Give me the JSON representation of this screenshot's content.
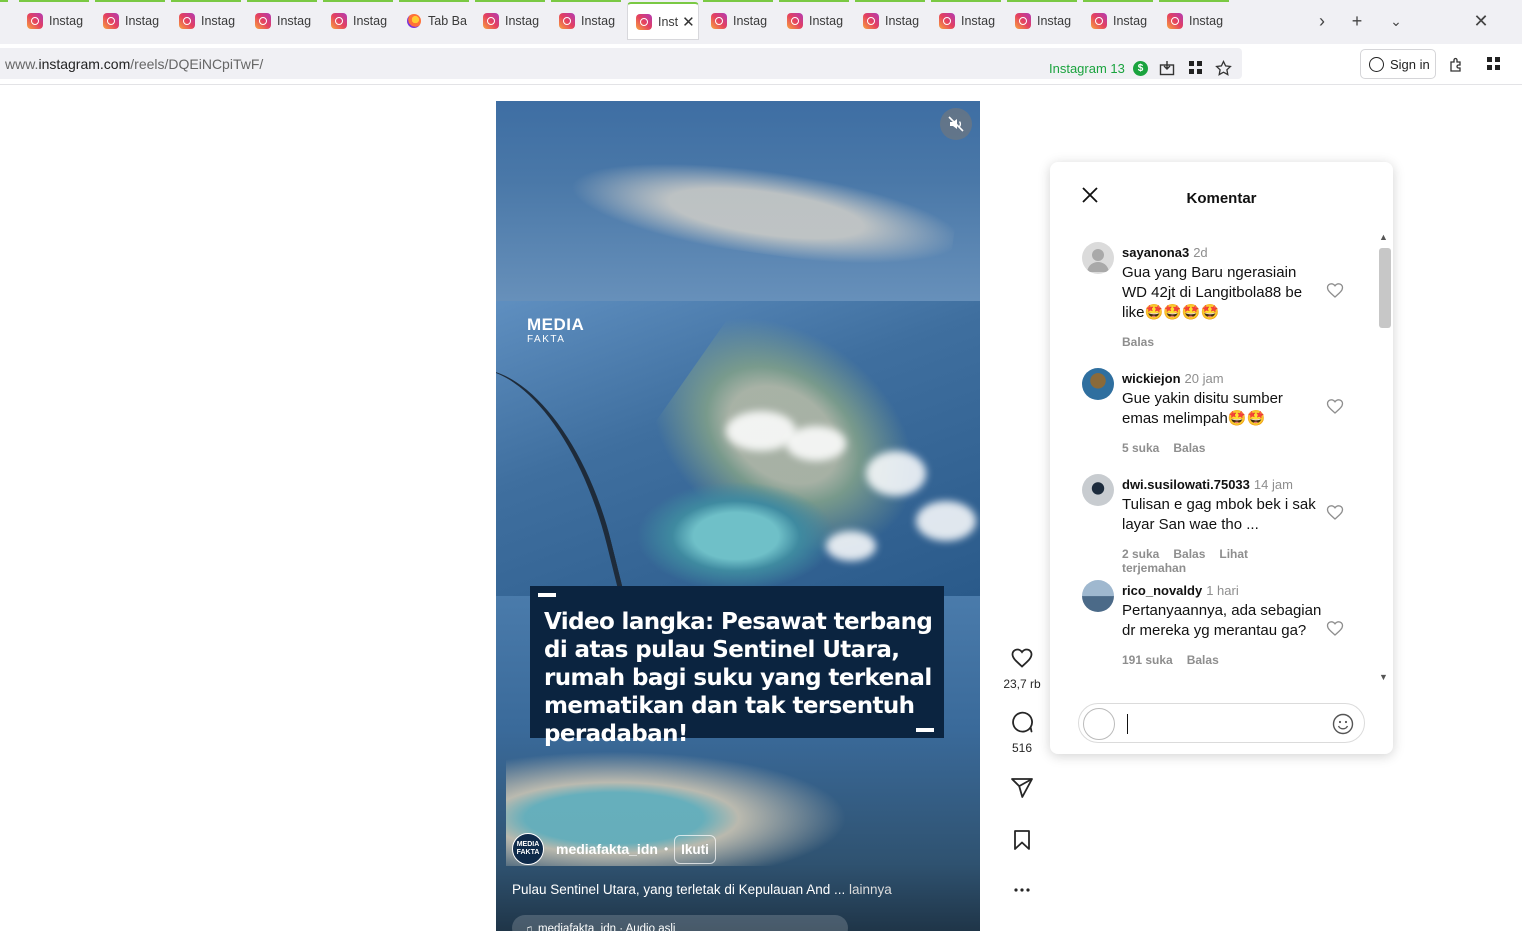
{
  "browser": {
    "tabs": [
      {
        "label": "",
        "icon": "instagram-icon"
      },
      {
        "label": "Instag",
        "icon": "instagram-icon"
      },
      {
        "label": "Instag",
        "icon": "instagram-icon"
      },
      {
        "label": "Instag",
        "icon": "instagram-icon"
      },
      {
        "label": "Instag",
        "icon": "instagram-icon"
      },
      {
        "label": "Instag",
        "icon": "instagram-icon"
      },
      {
        "label": "Tab Ba",
        "icon": "firefox-icon"
      },
      {
        "label": "Instag",
        "icon": "instagram-icon"
      },
      {
        "label": "Instag",
        "icon": "instagram-icon"
      },
      {
        "label": "Inst",
        "icon": "instagram-icon",
        "active": true
      },
      {
        "label": "Instag",
        "icon": "instagram-icon"
      },
      {
        "label": "Instag",
        "icon": "instagram-icon"
      },
      {
        "label": "Instag",
        "icon": "instagram-icon"
      },
      {
        "label": "Instag",
        "icon": "instagram-icon"
      },
      {
        "label": "Instag",
        "icon": "instagram-icon"
      },
      {
        "label": "Instag",
        "icon": "instagram-icon"
      },
      {
        "label": "Instag",
        "icon": "instagram-icon"
      }
    ],
    "url_prefix": "www.",
    "url_domain": "instagram.com",
    "url_path": "/reels/DQEiNCpiTwF/",
    "badge_label": "Instagram 13",
    "badge_currency": "$",
    "signin_label": "Sign in",
    "tab_accent_color": "#7ac943"
  },
  "reel": {
    "watermark_top": "MEDIA",
    "watermark_bottom": "FAKTA",
    "caption": "Video langka: Pesawat terbang di atas pulau Sentinel Utara, rumah bagi suku yang terkenal mematikan dan tak tersentuh peradaban!",
    "author_avatar_text": "MEDIA FAKTA",
    "author": "mediafakta_idn",
    "separator": "•",
    "follow_label": "Ikuti",
    "description": "Pulau Sentinel Utara, yang terletak di Kepulauan And ...",
    "more_label": "lainnya",
    "audio": "mediafakta_idn · Audio asli"
  },
  "actions": {
    "likes": "23,7 rb",
    "comments": "516"
  },
  "comments_panel": {
    "title": "Komentar",
    "items": [
      {
        "user": "sayanona3",
        "time": "2d",
        "text": "Gua yang Baru ngerasiain WD 42jt di Langitbola88 be like🤩🤩🤩🤩",
        "likes": "",
        "reply": "Balas",
        "translate": ""
      },
      {
        "user": "wickiejon",
        "time": "20 jam",
        "text": "Gue yakin disitu sumber emas melimpah🤩🤩",
        "likes": "5 suka",
        "reply": "Balas",
        "translate": ""
      },
      {
        "user": "dwi.susilowati.75033",
        "time": "14 jam",
        "text": "Tulisan e gag mbok bek i sak layar San wae tho ...",
        "likes": "2 suka",
        "reply": "Balas",
        "translate": "Lihat terjemahan"
      },
      {
        "user": "rico_novaldy",
        "time": "1 hari",
        "text": "Pertanyaannya, ada sebagian dr mereka yg merantau ga?",
        "likes": "191 suka",
        "reply": "Balas",
        "translate": ""
      }
    ]
  }
}
